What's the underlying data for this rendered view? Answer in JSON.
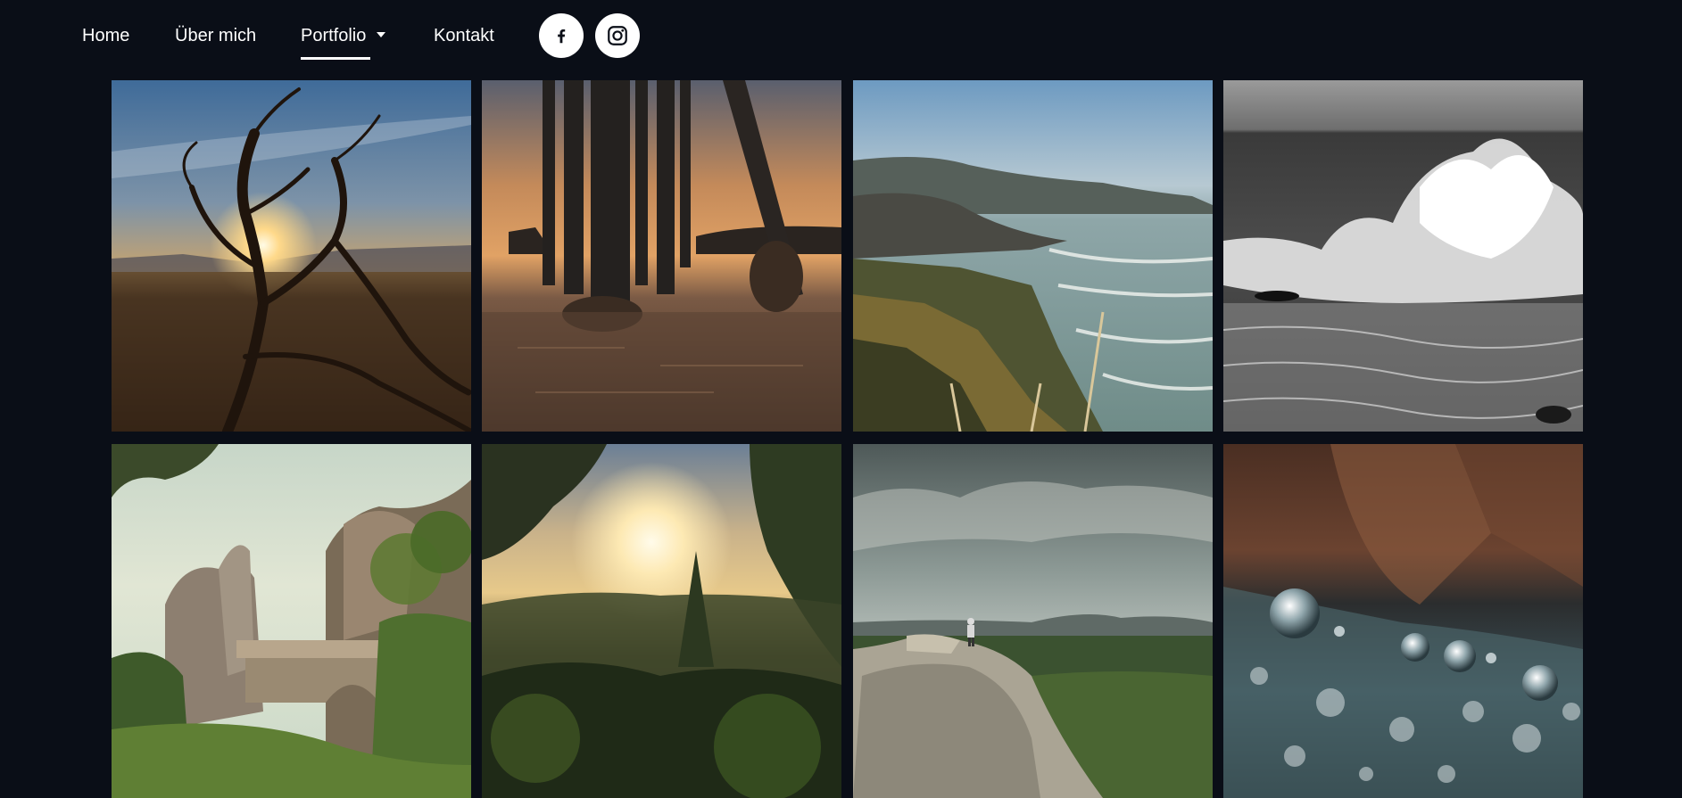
{
  "nav": {
    "items": [
      {
        "label": "Home"
      },
      {
        "label": "Über mich"
      },
      {
        "label": "Portfolio"
      },
      {
        "label": "Kontakt"
      }
    ],
    "active": "Portfolio",
    "social": [
      {
        "icon": "facebook-icon"
      },
      {
        "icon": "instagram-icon"
      }
    ]
  },
  "colors": {
    "background": "#0a0e17",
    "nav_text": "#ffffff",
    "social_bg": "#ffffff"
  },
  "gallery": {
    "photos": [
      {
        "subject": "dead tree at sunset"
      },
      {
        "subject": "pier pillars at sunset"
      },
      {
        "subject": "coastal cliffs and ocean"
      },
      {
        "subject": "black and white crashing wave"
      },
      {
        "subject": "sandstone rock bridge in forest"
      },
      {
        "subject": "sunset over forest"
      },
      {
        "subject": "hiker on rock under storm clouds"
      },
      {
        "subject": "water droplets macro"
      }
    ]
  }
}
